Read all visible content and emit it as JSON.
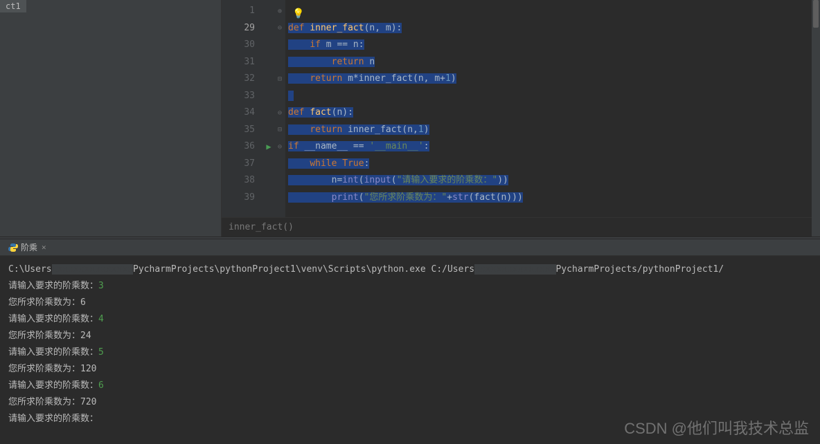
{
  "sidebar": {
    "tab": "ct1"
  },
  "editor": {
    "line_numbers": [
      "1",
      "29",
      "30",
      "31",
      "32",
      "33",
      "34",
      "35",
      "36",
      "37",
      "38",
      "39"
    ],
    "current_line_index": 1,
    "breadcrumb": "inner_fact()",
    "code": {
      "l29": {
        "def": "def ",
        "name": "inner_fact",
        "params": "(n, m):"
      },
      "l30": {
        "indent": "    ",
        "kw": "if ",
        "rest": "m == n:"
      },
      "l31": {
        "indent": "        ",
        "kw": "return ",
        "rest": "n"
      },
      "l32": {
        "indent": "    ",
        "kw": "return ",
        "rest": "m*inner_fact(n, m+",
        "num": "1",
        "close": ")"
      },
      "l34": {
        "def": "def ",
        "name": "fact",
        "params": "(n):"
      },
      "l35": {
        "indent": "    ",
        "kw": "return ",
        "rest": "inner_fact(n,",
        "num": "1",
        "close": ")"
      },
      "l36": {
        "kw": "if ",
        "var": "__name__ == ",
        "str": "'__main__'",
        "colon": ":"
      },
      "l37": {
        "indent": "    ",
        "kw": "while ",
        "val": "True",
        "colon": ":"
      },
      "l38": {
        "indent": "        ",
        "rest1": "n=",
        "builtin1": "int",
        "p1": "(",
        "builtin2": "input",
        "p2": "(",
        "str": "\"请输入要求的阶乘数：\"",
        "close": "))"
      },
      "l39": {
        "indent": "        ",
        "builtin": "print",
        "p1": "(",
        "str1": "\"您所求阶乘数为：\"",
        "plus": "+",
        "builtin2": "str",
        "p2": "(fact(n)))"
      }
    }
  },
  "run": {
    "tab_label": "阶乘",
    "console": {
      "path1a": "C:\\Users",
      "path1b": "PycharmProjects\\pythonProject1\\venv\\Scripts\\python.exe C:/Users",
      "path1c": "PycharmProjects/pythonProject1/",
      "lines": [
        {
          "prompt": "请输入要求的阶乘数：",
          "input": "3"
        },
        {
          "result": "您所求阶乘数为：6"
        },
        {
          "prompt": "请输入要求的阶乘数：",
          "input": "4"
        },
        {
          "result": "您所求阶乘数为：24"
        },
        {
          "prompt": "请输入要求的阶乘数：",
          "input": "5"
        },
        {
          "result": "您所求阶乘数为：120"
        },
        {
          "prompt": "请输入要求的阶乘数：",
          "input": "6"
        },
        {
          "result": "您所求阶乘数为：720"
        },
        {
          "prompt": "请输入要求的阶乘数："
        }
      ]
    }
  },
  "watermark": "CSDN @他们叫我技术总监"
}
